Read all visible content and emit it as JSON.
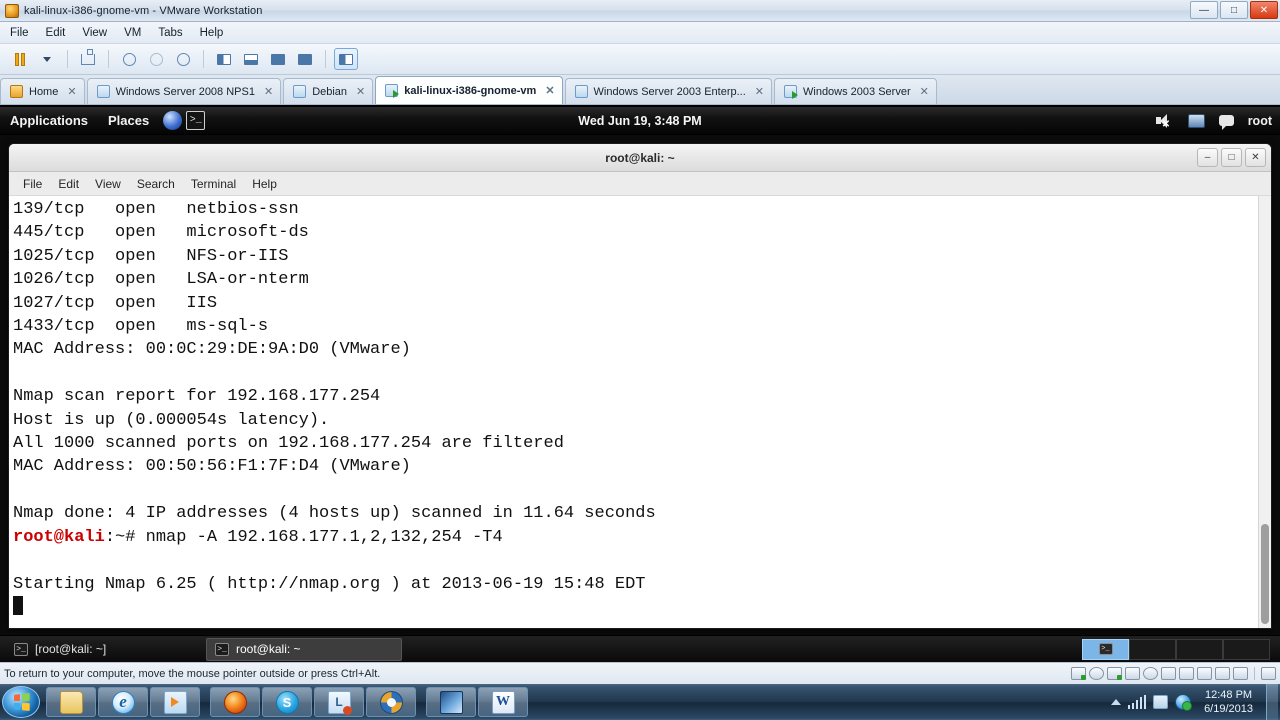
{
  "vmware": {
    "title": "kali-linux-i386-gnome-vm - VMware Workstation",
    "window_buttons": {
      "minimize": "—",
      "maximize": "□",
      "close": "✕"
    },
    "menu": [
      "File",
      "Edit",
      "View",
      "VM",
      "Tabs",
      "Help"
    ],
    "toolbar_icons": [
      "pause-icon",
      "dropdown-caret-icon",
      "snapshot-manager-icon",
      "take-snapshot-icon",
      "revert-snapshot-icon",
      "manage-snapshots-icon",
      "show-sidebar-icon",
      "show-thumbnails-icon",
      "fullscreen-icon",
      "unity-mode-icon",
      "console-view-icon"
    ],
    "tabs": [
      {
        "label": "Home",
        "icon": "home-icon",
        "active": false,
        "running": false
      },
      {
        "label": "Windows Server 2008 NPS1",
        "icon": "vm-icon",
        "active": false,
        "running": false
      },
      {
        "label": "Debian",
        "icon": "vm-icon",
        "active": false,
        "running": false
      },
      {
        "label": "kali-linux-i386-gnome-vm",
        "icon": "vm-icon",
        "active": true,
        "running": true
      },
      {
        "label": "Windows Server 2003 Enterp...",
        "icon": "vm-icon",
        "active": false,
        "running": false
      },
      {
        "label": "Windows 2003 Server",
        "icon": "vm-icon",
        "active": false,
        "running": true
      }
    ],
    "tab_close_glyph": "✕",
    "status_text": "To return to your computer, move the mouse pointer outside or press Ctrl+Alt."
  },
  "guest": {
    "top_panel": {
      "applications": "Applications",
      "places": "Places",
      "launchers": [
        "iceweasel-launcher-icon",
        "terminal-launcher-icon"
      ],
      "clock": "Wed Jun 19,  3:48 PM",
      "user": "root"
    },
    "terminal": {
      "title": "root@kali: ~",
      "window_buttons": {
        "minimize": "‒",
        "maximize": "□",
        "close": "✕"
      },
      "menu": [
        "File",
        "Edit",
        "View",
        "Search",
        "Terminal",
        "Help"
      ],
      "lines": [
        "139/tcp   open   netbios-ssn",
        "445/tcp   open   microsoft-ds",
        "1025/tcp  open   NFS-or-IIS",
        "1026/tcp  open   LSA-or-nterm",
        "1027/tcp  open   IIS",
        "1433/tcp  open   ms-sql-s",
        "MAC Address: 00:0C:29:DE:9A:D0 (VMware)",
        "",
        "Nmap scan report for 192.168.177.254",
        "Host is up (0.000054s latency).",
        "All 1000 scanned ports on 192.168.177.254 are filtered",
        "MAC Address: 00:50:56:F1:7F:D4 (VMware)",
        "",
        "Nmap done: 4 IP addresses (4 hosts up) scanned in 11.64 seconds"
      ],
      "prompt": "root@kali",
      "prompt_tail": ":~# ",
      "command": "nmap -A 192.168.177.1,2,132,254 -T4",
      "post_lines": [
        "",
        "Starting Nmap 6.25 ( http://nmap.org ) at 2013-06-19 15:48 EDT"
      ],
      "prompt_color": "#cc0000"
    },
    "bottom_panel": {
      "windows": [
        {
          "label": "[root@kali: ~]",
          "active": false
        },
        {
          "label": "root@kali: ~",
          "active": true
        }
      ],
      "workspaces": [
        {
          "active": true
        },
        {
          "active": false
        },
        {
          "active": false
        },
        {
          "active": false
        }
      ]
    }
  },
  "windows_taskbar": {
    "start_label": "Start",
    "items": [
      "windows-explorer-icon",
      "internet-explorer-icon",
      "windows-media-player-icon",
      "firefox-icon",
      "skype-icon",
      "lightshot-icon",
      "vmware-player-icon",
      "vmware-workstation-icon",
      "microsoft-word-icon"
    ],
    "tray": {
      "show_hidden_icons": "show-hidden-icons-arrow",
      "network_icon": "network-signal-icon",
      "volume_icon": "volume-icon",
      "action_center_icon": "action-center-icon",
      "time": "12:48 PM",
      "date": "6/19/2013"
    }
  }
}
